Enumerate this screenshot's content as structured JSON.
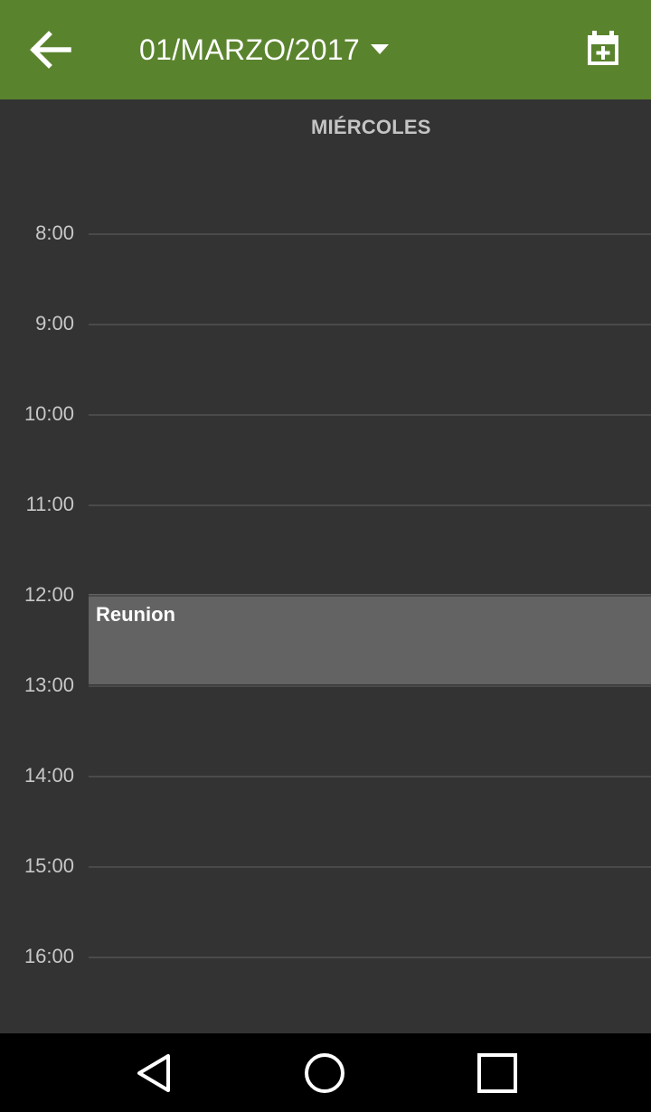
{
  "appbar": {
    "date_label": "01/MARZO/2017",
    "back_icon": "arrow-back-icon",
    "dropdown_icon": "caret-down-icon",
    "add_event_icon": "calendar-add-icon",
    "color": "#5a832e"
  },
  "day": {
    "weekday": "MIÉRCOLES"
  },
  "hours": [
    "8:00",
    "9:00",
    "10:00",
    "11:00",
    "12:00",
    "13:00",
    "14:00",
    "15:00",
    "16:00"
  ],
  "events": [
    {
      "title": "Reunion",
      "start": "12:00",
      "end": "13:00",
      "color": "#636363"
    }
  ],
  "navbar": {
    "back_icon": "triangle-back-icon",
    "home_icon": "circle-home-icon",
    "recents_icon": "square-recents-icon"
  }
}
